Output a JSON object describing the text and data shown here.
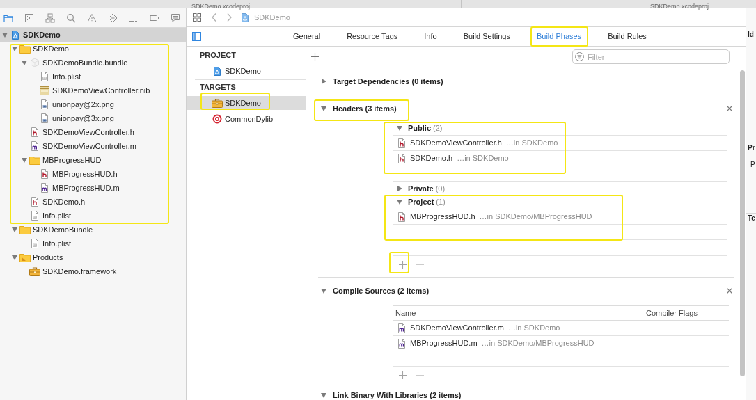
{
  "document_tabs": [
    {
      "title": "SDKDemo.xcodeproj"
    },
    {
      "title": "SDKDemo.xcodeproj"
    }
  ],
  "navigator": {
    "tabs": [
      {
        "selected": true
      },
      {
        "selected": false
      },
      {
        "selected": false
      },
      {
        "selected": false
      },
      {
        "selected": false
      },
      {
        "selected": false
      },
      {
        "selected": false
      },
      {
        "selected": false
      },
      {
        "selected": false
      }
    ],
    "tree": [
      {
        "name": "SDKDemo",
        "kind": "project",
        "expanded": true,
        "selected": true,
        "highlighted": false,
        "children": [
          {
            "name": "SDKDemo",
            "kind": "folder",
            "expanded": true,
            "selected": false,
            "highlighted": true,
            "children": [
              {
                "name": "SDKDemoBundle.bundle",
                "kind": "bundle",
                "expanded": true,
                "selected": false,
                "highlighted": false,
                "children": [
                  {
                    "name": "Info.plist",
                    "kind": "plist",
                    "selected": false,
                    "highlighted": false
                  },
                  {
                    "name": "SDKDemoViewController.nib",
                    "kind": "nib",
                    "selected": false,
                    "highlighted": false
                  },
                  {
                    "name": "unionpay@2x.png",
                    "kind": "image",
                    "selected": false,
                    "highlighted": false
                  },
                  {
                    "name": "unionpay@3x.png",
                    "kind": "image",
                    "selected": false,
                    "highlighted": false
                  }
                ]
              },
              {
                "name": "SDKDemoViewController.h",
                "kind": "header",
                "selected": false,
                "highlighted": false
              },
              {
                "name": "SDKDemoViewController.m",
                "kind": "source",
                "selected": false,
                "highlighted": false
              },
              {
                "name": "MBProgressHUD",
                "kind": "folder",
                "expanded": true,
                "selected": false,
                "highlighted": false,
                "children": [
                  {
                    "name": "MBProgressHUD.h",
                    "kind": "header",
                    "selected": false,
                    "highlighted": false
                  },
                  {
                    "name": "MBProgressHUD.m",
                    "kind": "source",
                    "selected": false,
                    "highlighted": false
                  }
                ]
              },
              {
                "name": "SDKDemo.h",
                "kind": "header",
                "selected": false,
                "highlighted": false
              },
              {
                "name": "Info.plist",
                "kind": "plist",
                "selected": false,
                "highlighted": false
              }
            ]
          },
          {
            "name": "SDKDemoBundle",
            "kind": "folder",
            "expanded": true,
            "selected": false,
            "highlighted": false,
            "children": [
              {
                "name": "Info.plist",
                "kind": "plist",
                "selected": false,
                "highlighted": false
              }
            ]
          },
          {
            "name": "Products",
            "kind": "products",
            "expanded": true,
            "selected": false,
            "highlighted": false,
            "children": [
              {
                "name": "SDKDemo.framework",
                "kind": "framework",
                "selected": false,
                "highlighted": false
              }
            ]
          }
        ]
      }
    ]
  },
  "editor": {
    "breadcrumb": {
      "title": "SDKDemo"
    },
    "tabs": [
      {
        "label": "General",
        "selected": false,
        "highlighted": false
      },
      {
        "label": "Resource Tags",
        "selected": false,
        "highlighted": false
      },
      {
        "label": "Info",
        "selected": false,
        "highlighted": false
      },
      {
        "label": "Build Settings",
        "selected": false,
        "highlighted": false
      },
      {
        "label": "Build Phases",
        "selected": true,
        "highlighted": true
      },
      {
        "label": "Build Rules",
        "selected": false,
        "highlighted": false
      }
    ],
    "targets_list": [
      {
        "heading": "PROJECT",
        "items": [
          {
            "name": "SDKDemo",
            "kind": "project",
            "selected": false,
            "highlighted": false
          }
        ]
      },
      {
        "heading": "TARGETS",
        "items": [
          {
            "name": "SDKDemo",
            "kind": "framework",
            "selected": true,
            "highlighted": true
          },
          {
            "name": "CommonDylib",
            "kind": "dylib",
            "selected": false,
            "highlighted": false
          }
        ]
      }
    ],
    "filter": {
      "placeholder": "Filter"
    },
    "phases": [
      {
        "title": "Target Dependencies (0 items)",
        "expanded": false,
        "highlighted": false,
        "closable": false
      },
      {
        "kind": "headers",
        "title": "Headers (3 items)",
        "expanded": true,
        "highlighted": true,
        "closable": true,
        "add_highlighted": true,
        "groups": [
          {
            "title": "Public",
            "count": "(2)",
            "expanded": true,
            "highlighted": true,
            "files": [
              {
                "name": "SDKDemoViewController.h",
                "kind": "header",
                "location": "…in SDKDemo"
              },
              {
                "name": "SDKDemo.h",
                "kind": "header",
                "location": "…in SDKDemo"
              }
            ]
          },
          {
            "title": "Private",
            "count": "(0)",
            "expanded": false,
            "highlighted": false
          },
          {
            "title": "Project",
            "count": "(1)",
            "expanded": true,
            "highlighted": true,
            "files": [
              {
                "name": "MBProgressHUD.h",
                "kind": "header",
                "location": "…in SDKDemo/MBProgressHUD"
              }
            ]
          }
        ]
      },
      {
        "kind": "table",
        "title": "Compile Sources (2 items)",
        "expanded": true,
        "highlighted": false,
        "closable": true,
        "add_highlighted": false,
        "columns": [
          "Name",
          "Compiler Flags"
        ],
        "files": [
          {
            "name": "SDKDemoViewController.m",
            "kind": "source",
            "location": "…in SDKDemo"
          },
          {
            "name": "MBProgressHUD.m",
            "kind": "source",
            "location": "…in SDKDemo/MBProgressHUD"
          }
        ]
      },
      {
        "title": "Link Binary With Libraries (2 items)",
        "expanded": true,
        "highlighted": false,
        "closable": false
      }
    ]
  },
  "inspector": [
    {
      "text": "Id",
      "kind": "heading"
    },
    {
      "text": "Pr",
      "kind": "heading"
    },
    {
      "text": "P",
      "kind": "label"
    },
    {
      "text": "Te",
      "kind": "heading"
    }
  ]
}
